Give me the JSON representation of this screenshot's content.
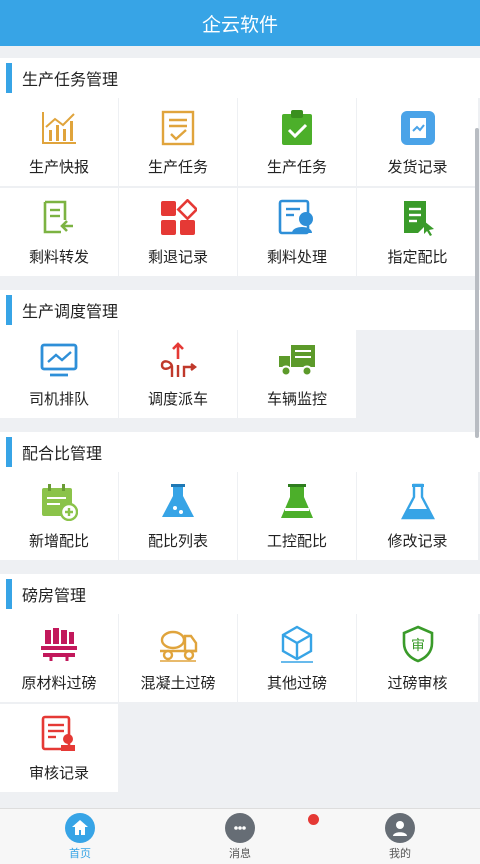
{
  "app": {
    "title": "企云软件"
  },
  "sections": [
    {
      "title": "生产任务管理",
      "items": [
        {
          "label": "生产快报",
          "icon": "chart-icon"
        },
        {
          "label": "生产任务",
          "icon": "checklist-icon"
        },
        {
          "label": "生产任务",
          "icon": "clipboard-check-icon"
        },
        {
          "label": "发货记录",
          "icon": "shipment-record-icon"
        },
        {
          "label": "剩料转发",
          "icon": "document-forward-icon"
        },
        {
          "label": "剩退记录",
          "icon": "grid-blocks-icon"
        },
        {
          "label": "剩料处理",
          "icon": "material-handle-icon"
        },
        {
          "label": "指定配比",
          "icon": "document-cursor-icon"
        }
      ]
    },
    {
      "title": "生产调度管理",
      "items": [
        {
          "label": "司机排队",
          "icon": "monitor-icon"
        },
        {
          "label": "调度派车",
          "icon": "dispatch-route-icon"
        },
        {
          "label": "车辆监控",
          "icon": "truck-icon"
        }
      ]
    },
    {
      "title": "配合比管理",
      "items": [
        {
          "label": "新增配比",
          "icon": "calendar-add-icon"
        },
        {
          "label": "配比列表",
          "icon": "flask-icon"
        },
        {
          "label": "工控配比",
          "icon": "beaker-icon"
        },
        {
          "label": "修改记录",
          "icon": "flask-edit-icon"
        }
      ]
    },
    {
      "title": "磅房管理",
      "items": [
        {
          "label": "原材料过磅",
          "icon": "scale-icon"
        },
        {
          "label": "混凝土过磅",
          "icon": "mixer-truck-icon"
        },
        {
          "label": "其他过磅",
          "icon": "box-icon"
        },
        {
          "label": "过磅审核",
          "icon": "shield-audit-icon"
        },
        {
          "label": "审核记录",
          "icon": "audit-record-icon"
        }
      ]
    }
  ],
  "tabs": [
    {
      "label": "首页",
      "icon": "home-icon"
    },
    {
      "label": "消息",
      "icon": "chat-icon"
    },
    {
      "label": "我的",
      "icon": "user-icon"
    }
  ]
}
